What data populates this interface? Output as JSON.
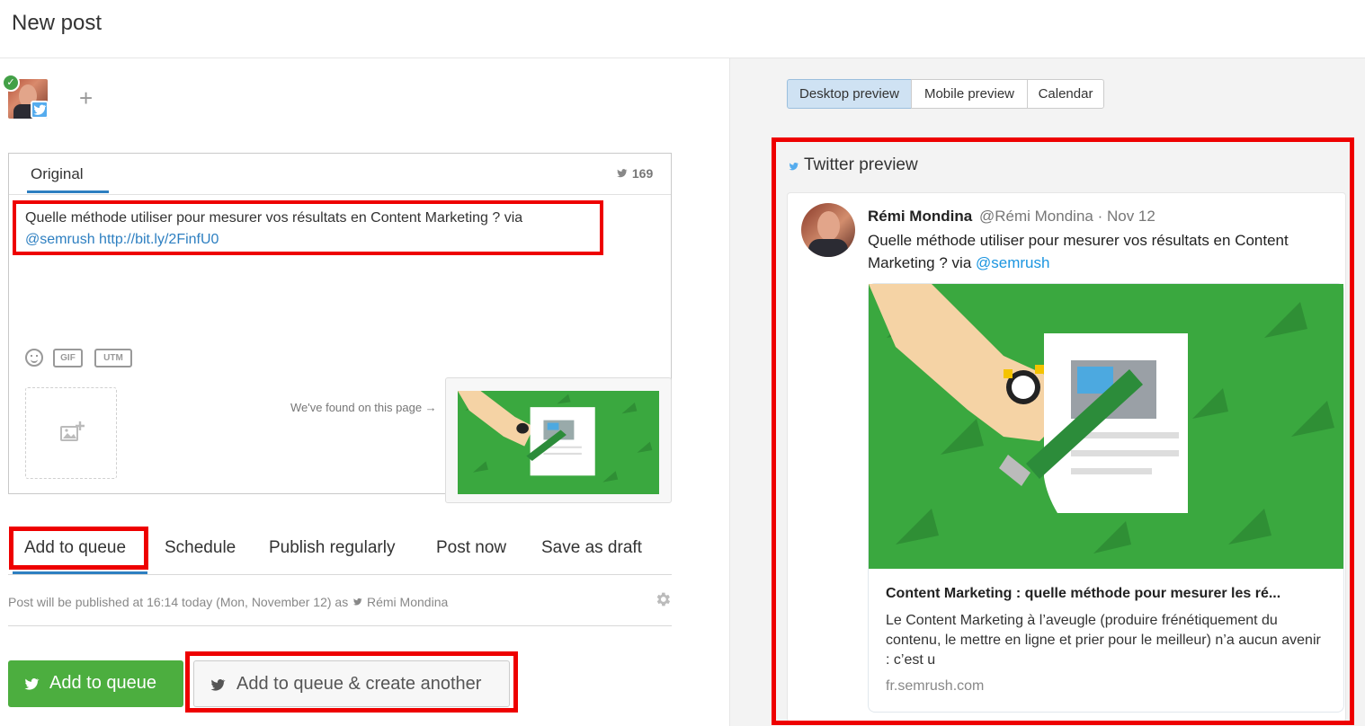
{
  "page": {
    "title": "New post"
  },
  "composer": {
    "tab_original": "Original",
    "char_count": "169",
    "text": "Quelle méthode utiliser pour mesurer vos résultats en Content Marketing ? via",
    "mention": "@semrush",
    "url": "http://bit.ly/2FinfU0",
    "gif_label": "GIF",
    "utm_label": "UTM",
    "found_text": "We've found on this page →"
  },
  "action_tabs": {
    "add_to_queue": "Add to queue",
    "schedule": "Schedule",
    "publish_regularly": "Publish regularly",
    "post_now": "Post now",
    "save_as_draft": "Save as draft"
  },
  "publish_info": {
    "prefix": "Post will be published at 16:14 today (Mon, November 12) as",
    "account": "Rémi Mondina"
  },
  "buttons": {
    "add_to_queue": "Add to queue",
    "add_to_queue_another": "Add to queue & create another"
  },
  "preview_tabs": {
    "desktop": "Desktop preview",
    "mobile": "Mobile preview",
    "calendar": "Calendar"
  },
  "twitter_preview": {
    "title": "Twitter preview",
    "name": "Rémi Mondina",
    "handle": "@Rémi Mondina · Nov 12",
    "text": "Quelle méthode utiliser pour mesurer vos résultats en Content Marketing ? via",
    "mention": "@semrush",
    "card_title": "Content Marketing : quelle méthode pour mesurer les ré...",
    "card_description": "Le Content Marketing à l’aveugle (produire frénétiquement du contenu, le mettre en ligne et prier pour le meilleur) n’a aucun avenir : c’est u",
    "card_domain": "fr.semrush.com"
  },
  "colors": {
    "accent_blue": "#2d7fc1",
    "twitter_blue": "#55acee",
    "primary_green": "#4cae3f",
    "highlight_red": "#ee0000",
    "image_green": "#3aa83f"
  },
  "icons": [
    "check-icon",
    "twitter-icon",
    "plus-icon",
    "emoji-icon",
    "add-image-icon",
    "gear-icon",
    "twitter-bird-icon"
  ]
}
